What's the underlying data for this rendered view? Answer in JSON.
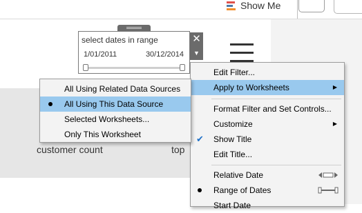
{
  "toolbar": {
    "show_me_label": "Show Me",
    "show_me_colors": [
      "#e0504a",
      "#4e79a7",
      "#f28e2b"
    ]
  },
  "worksheet": {
    "customer_count_label": "customer count",
    "top_label": "top"
  },
  "filter_card": {
    "title": "select dates in range",
    "start_date": "1/01/2011",
    "end_date": "30/12/2014",
    "close_glyph": "✕",
    "dropdown_glyph": "▼"
  },
  "context_menu": {
    "items": [
      {
        "label": "Edit Filter..."
      },
      {
        "label": "Apply to Worksheets",
        "submenu": true,
        "highlighted": true
      },
      {
        "label": "Format Filter and Set Controls..."
      },
      {
        "label": "Customize",
        "submenu": true
      },
      {
        "label": "Show Title",
        "checked": true
      },
      {
        "label": "Edit Title..."
      },
      {
        "label": "Relative Date",
        "icon": "relative-date-icon"
      },
      {
        "label": "Range of Dates",
        "icon": "range-of-dates-icon",
        "selected": true
      },
      {
        "label": "Start Date"
      }
    ]
  },
  "submenu": {
    "items": [
      {
        "label": "All Using Related Data Sources"
      },
      {
        "label": "All Using This Data Source",
        "selected": true,
        "highlighted": true
      },
      {
        "label": "Selected Worksheets..."
      },
      {
        "label": "Only This Worksheet"
      }
    ]
  },
  "colors": {
    "menu_highlight": "#99c9ee",
    "check_blue": "#1c6fc7",
    "card_header": "#6b6b6b"
  }
}
